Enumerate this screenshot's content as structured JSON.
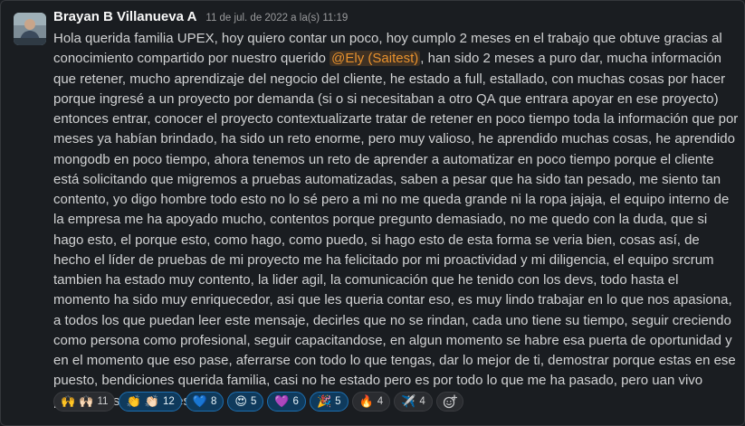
{
  "message": {
    "author": "Brayan B Villanueva A",
    "timestamp": "11 de jul. de 2022 a la(s) 11:19",
    "text_before_mention": "Hola querida familia UPEX, hoy quiero contar un poco, hoy cumplo 2 meses en el trabajo que obtuve gracias al conocimiento compartido por nuestro querido ",
    "mention": "@Ely (Saitest)",
    "text_after_mention": ", han sido 2 meses a puro dar, mucha información que retener, mucho aprendizaje del negocio del cliente, he estado a full, estallado, con muchas cosas por hacer porque ingresé a un proyecto por demanda (si o si necesitaban a otro QA que entrara apoyar en ese proyecto) entonces entrar, conocer el proyecto contextualizarte tratar de retener en poco tiempo toda la información  que por meses ya habían brindado, ha sido un reto enorme, pero muy valioso, he aprendido muchas cosas, he aprendido mongodb en poco tiempo, ahora tenemos un reto de aprender a automatizar en poco tiempo porque el cliente está solicitando que migremos a pruebas automatizadas, saben a pesar que ha sido tan pesado, me siento tan contento, yo digo hombre todo esto no lo sé pero a mi no me queda grande ni la ropa jajaja, el equipo interno de la empresa me ha apoyado mucho, contentos porque pregunto demasiado, no me quedo con la duda, que si hago esto, el porque esto, como hago, como puedo, si hago esto de esta forma se veria bien, cosas así, de hecho el líder de pruebas de mi proyecto me ha felicitado por mi proactividad y mi diligencia, el equipo srcrum tambien ha estado muy contento, la lider agil, la comunicación que he tenido con los devs, todo hasta el momento ha sido muy enriquecedor, asi que les queria contar eso, es muy lindo trabajar en lo que nos apasiona,  a todos los que puedan leer este mensaje, decirles que no se rindan, cada uno tiene su tiempo, seguir creciendo como persona como profesional, seguir capacitandose, en algun momento se habre esa puerta de oportunidad y en el momento que eso pase, aferrarse con todo lo que tengas, dar lo mejor de ti, demostrar porque estas en ese puesto, bendiciones querida familia, casi no he estado pero es por todo lo que me ha pasado, pero uan vivo pendientes de ustedes."
  },
  "reactions": [
    {
      "name": "reaction-raised-hands",
      "emoji": "🙌 🙌🏻",
      "count": "11",
      "mine": false
    },
    {
      "name": "reaction-clap",
      "emoji": "👏 👏🏻",
      "count": "12",
      "mine": true
    },
    {
      "name": "reaction-blue-heart",
      "emoji": "💙",
      "count": "8",
      "mine": true
    },
    {
      "name": "reaction-heart-eyes",
      "emoji": "😍",
      "count": "5",
      "mine": true
    },
    {
      "name": "reaction-purple-heart",
      "emoji": "💜",
      "count": "6",
      "mine": true
    },
    {
      "name": "reaction-tada",
      "emoji": "🎉",
      "count": "5",
      "mine": true
    },
    {
      "name": "reaction-fire",
      "emoji": "🔥",
      "count": "4",
      "mine": false
    },
    {
      "name": "reaction-airplane",
      "emoji": "✈️",
      "count": "4",
      "mine": false
    }
  ],
  "add_reaction_icon": "add-reaction-icon",
  "colors": {
    "background": "#1a1d21",
    "mention": "#e8912d",
    "reaction_selected_border": "#1d6fb0"
  }
}
